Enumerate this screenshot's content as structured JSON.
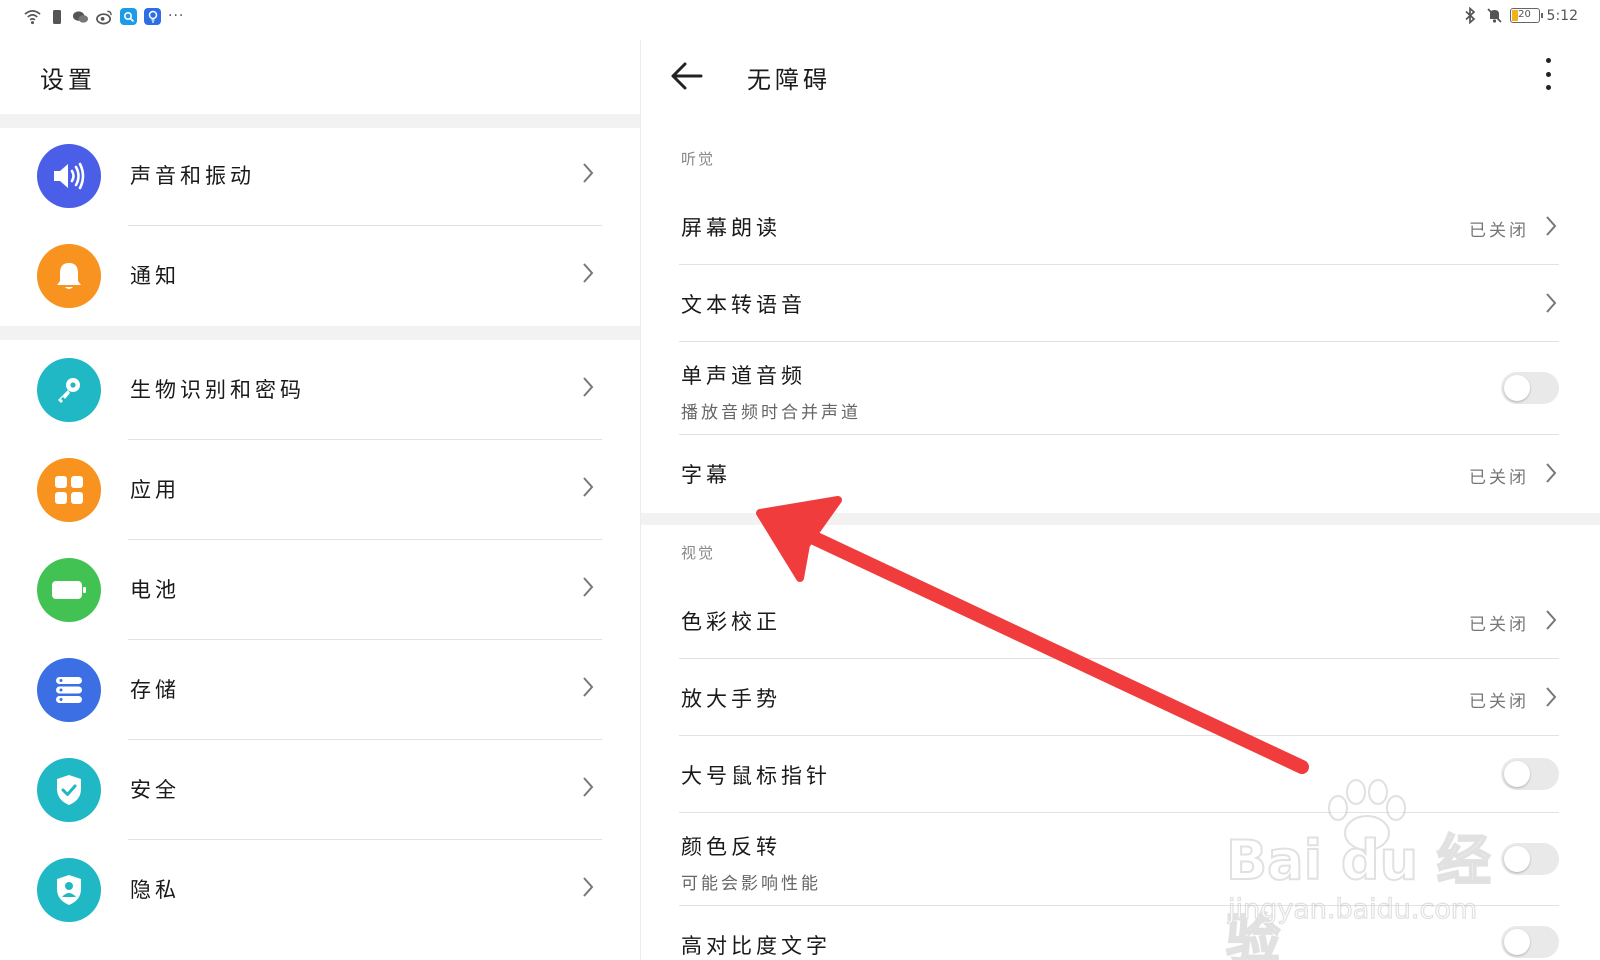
{
  "status_bar": {
    "left_icons": [
      "wifi-icon",
      "sim-icon",
      "wechat-icon",
      "weibo-icon",
      "search-app-icon",
      "bulb-app-icon"
    ],
    "more": "···",
    "right_icons": [
      "bluetooth-icon",
      "mute-icon"
    ],
    "battery": "20",
    "time": "5:12"
  },
  "left": {
    "title": "设置",
    "items": [
      {
        "label": "声音和振动",
        "icon": "volume-icon",
        "color": "#4b5ee8"
      },
      {
        "label": "通知",
        "icon": "bell-icon",
        "color": "#f7931e"
      },
      {
        "label": "生物识别和密码",
        "icon": "key-icon",
        "color": "#1fb8c4"
      },
      {
        "label": "应用",
        "icon": "apps-grid-icon",
        "color": "#f7931e"
      },
      {
        "label": "电池",
        "icon": "battery-icon",
        "color": "#43c254"
      },
      {
        "label": "存储",
        "icon": "storage-icon",
        "color": "#3b6fe3"
      },
      {
        "label": "安全",
        "icon": "shield-check-icon",
        "color": "#1fb8c4"
      },
      {
        "label": "隐私",
        "icon": "privacy-icon",
        "color": "#1fb8c4"
      }
    ]
  },
  "right": {
    "title": "无障碍",
    "sections": [
      {
        "label": "听觉",
        "rows": [
          {
            "label": "屏幕朗读",
            "status": "已关闭",
            "control": "chevron"
          },
          {
            "label": "文本转语音",
            "control": "chevron"
          },
          {
            "label": "单声道音频",
            "sub": "播放音频时合并声道",
            "control": "toggle",
            "on": false
          },
          {
            "label": "字幕",
            "status": "已关闭",
            "control": "chevron"
          }
        ]
      },
      {
        "label": "视觉",
        "rows": [
          {
            "label": "色彩校正",
            "status": "已关闭",
            "control": "chevron"
          },
          {
            "label": "放大手势",
            "status": "已关闭",
            "control": "chevron"
          },
          {
            "label": "大号鼠标指针",
            "control": "toggle",
            "on": false
          },
          {
            "label": "颜色反转",
            "sub": "可能会影响性能",
            "control": "toggle",
            "on": false
          },
          {
            "label": "高对比度文字",
            "control": "toggle",
            "on": false
          }
        ]
      }
    ]
  },
  "annotation": {
    "color": "#f03c3c"
  },
  "watermark": {
    "line1": "Bai du 经验",
    "line2": "jingyan.baidu.com"
  }
}
